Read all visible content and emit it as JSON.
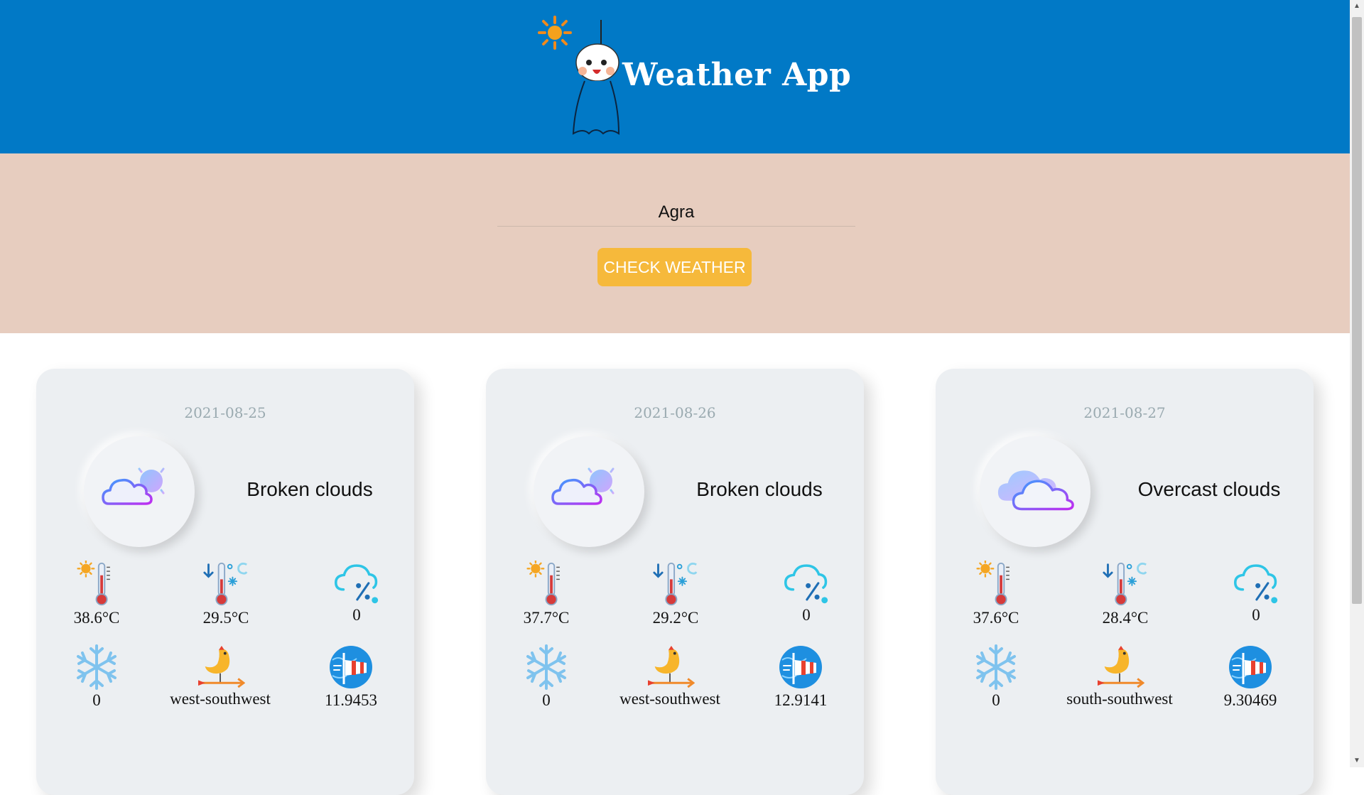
{
  "header": {
    "title": "Weather App"
  },
  "search": {
    "city_value": "Agra",
    "button_label": "CHECK WEATHER"
  },
  "colors": {
    "header_bg": "#0179c6",
    "search_bg": "#e7cdbf",
    "button_bg": "#f6b93b",
    "card_bg": "#eceff2"
  },
  "forecast": [
    {
      "date": "2021-08-25",
      "description": "Broken clouds",
      "icon": "broken-clouds-icon",
      "max_temp": "38.6°C",
      "min_temp": "29.5°C",
      "humidity_precip": "0",
      "snow": "0",
      "wind_direction": "west-southwest",
      "wind_speed": "11.9453"
    },
    {
      "date": "2021-08-26",
      "description": "Broken clouds",
      "icon": "broken-clouds-icon",
      "max_temp": "37.7°C",
      "min_temp": "29.2°C",
      "humidity_precip": "0",
      "snow": "0",
      "wind_direction": "west-southwest",
      "wind_speed": "12.9141"
    },
    {
      "date": "2021-08-27",
      "description": "Overcast clouds",
      "icon": "overcast-clouds-icon",
      "max_temp": "37.6°C",
      "min_temp": "28.4°C",
      "humidity_precip": "0",
      "snow": "0",
      "wind_direction": "south-southwest",
      "wind_speed": "9.30469"
    }
  ]
}
